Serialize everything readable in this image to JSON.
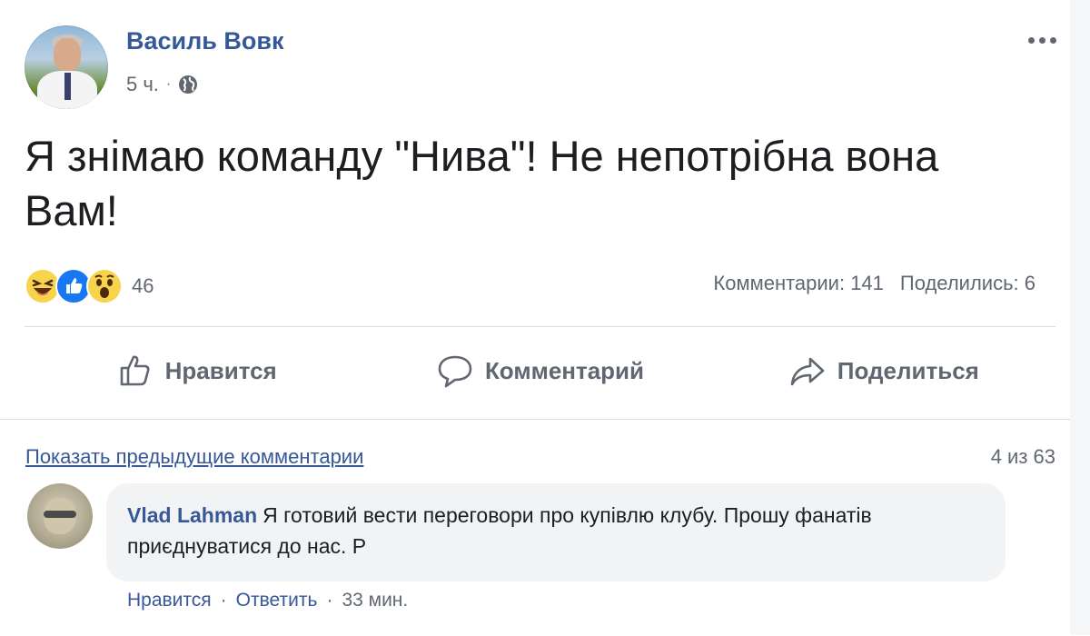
{
  "post": {
    "author": "Василь Вовк",
    "time": "5 ч.",
    "meta_separator": "·",
    "text": "Я знімаю команду \"Нива\"! Не непотрібна вона Вам!"
  },
  "reactions": {
    "count": "46",
    "types": [
      "haha",
      "like",
      "wow"
    ]
  },
  "stats": {
    "comments": "Комментарии: 141",
    "shares": "Поделились: 6"
  },
  "actions": {
    "like": "Нравится",
    "comment": "Комментарий",
    "share": "Поделиться"
  },
  "comments": {
    "show_previous": "Показать предыдущие комментарии",
    "count_label": "4 из 63",
    "items": [
      {
        "author": "Vlad Lahman",
        "text": "Я готовий вести переговори про купівлю клубу. Прошу фанатів приєднуватися до нас. Р",
        "like": "Нравится",
        "reply": "Ответить",
        "time": "33 мин.",
        "separator": "·"
      }
    ]
  },
  "colors": {
    "link_blue": "#365899",
    "secondary_text": "#606770",
    "like_blue": "#1877f2",
    "emoji_yellow": "#f7d44c",
    "bubble_bg": "#f2f3f5"
  }
}
